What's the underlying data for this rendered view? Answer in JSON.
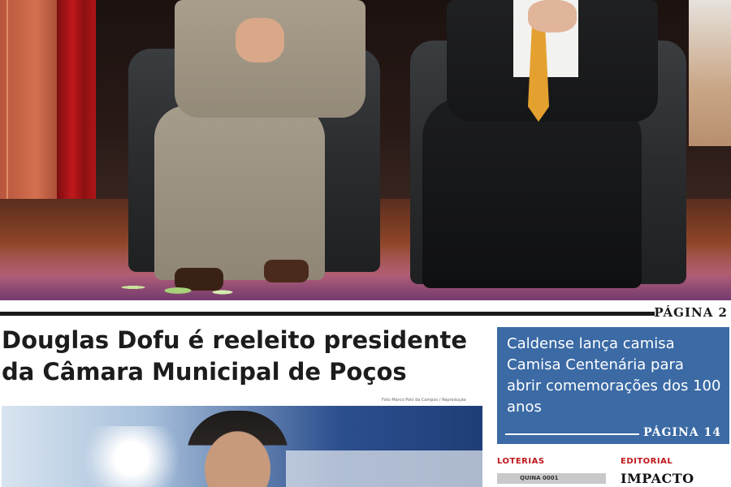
{
  "top_story": {
    "page_ref": "PÁGINA 2"
  },
  "main_story": {
    "headline_line1": "Douglas Dofu é reeleito presidente",
    "headline_line2": "da Câmara Municipal de Poços",
    "photo_credit": "Foto Marco Polo da Campos / Reprodução"
  },
  "sidebar": {
    "text": "Caldense lança camisa Camisa Centenária para abrir comemorações dos 100 anos",
    "page_ref": "PÁGINA 14",
    "box_color": "#3b6aa5"
  },
  "columns": {
    "loterias_label": "LOTERIAS",
    "loterias_bar": "QUINA 0001",
    "editorial_label": "EDITORIAL",
    "editorial_title": "IMPACTO"
  },
  "colors": {
    "accent_red": "#c0171c",
    "ink": "#1c1c1c"
  }
}
